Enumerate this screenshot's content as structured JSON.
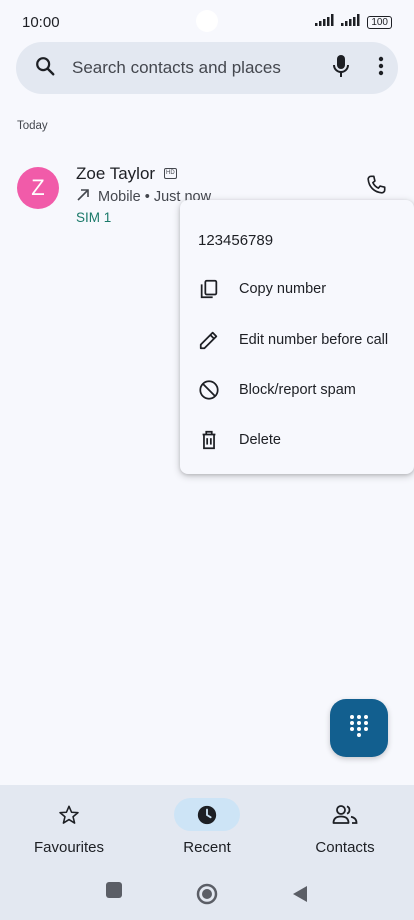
{
  "status_bar": {
    "time": "10:00",
    "battery": "100",
    "icons": [
      "signal-icon",
      "signal-icon",
      "battery-icon"
    ]
  },
  "search": {
    "placeholder": "Search contacts and places",
    "icons": [
      "search-icon",
      "mic-icon",
      "more-vert-icon"
    ]
  },
  "recents": {
    "section_label": "Today",
    "items": [
      {
        "avatar_letter": "Z",
        "avatar_color": "#f15ba9",
        "name": "Zoe Taylor",
        "hd_badge": "HD",
        "call_type_icon": "outgoing-arrow-icon",
        "meta": "Mobile • Just now",
        "sim": "SIM 1"
      }
    ]
  },
  "context_menu": {
    "number": "123456789",
    "items": [
      {
        "label": "Copy number",
        "icon": "copy-icon"
      },
      {
        "label": "Edit number before call",
        "icon": "pencil-icon"
      },
      {
        "label": "Block/report spam",
        "icon": "block-icon"
      },
      {
        "label": "Delete",
        "icon": "trash-icon"
      }
    ]
  },
  "fab": {
    "icon": "dialpad-icon",
    "color": "#125f8f"
  },
  "bottom_nav": {
    "items": [
      {
        "label": "Favourites",
        "icon": "star-icon",
        "active": false
      },
      {
        "label": "Recent",
        "icon": "clock-icon",
        "active": true
      },
      {
        "label": "Contacts",
        "icon": "people-icon",
        "active": false
      }
    ]
  },
  "system_nav": {
    "icons": [
      "recents-square-icon",
      "home-circle-icon",
      "back-triangle-icon"
    ]
  },
  "colors": {
    "accent": "#125f8f",
    "sim_text": "#1b7a6a",
    "surface": "#e3e8f1",
    "active_pill": "#cde4f6"
  }
}
